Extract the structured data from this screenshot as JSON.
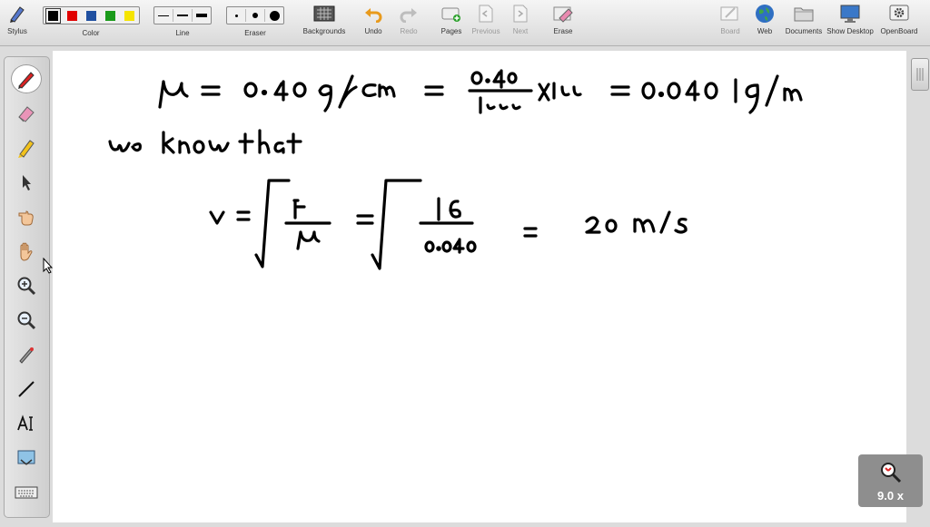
{
  "toolbar": {
    "stylus": "Stylus",
    "color": "Color",
    "line": "Line",
    "eraser": "Eraser",
    "backgrounds": "Backgrounds",
    "undo": "Undo",
    "redo": "Redo",
    "pages": "Pages",
    "previous": "Previous",
    "next": "Next",
    "erase": "Erase",
    "board": "Board",
    "web": "Web",
    "documents": "Documents",
    "show_desktop": "Show Desktop",
    "openboard": "OpenBoard"
  },
  "colors": {
    "swatches": [
      "#000000",
      "#e00000",
      "#1f4fa0",
      "#1a9a1a",
      "#f5e400"
    ],
    "selected_index": 0
  },
  "zoom": {
    "label": "9.0 x"
  }
}
